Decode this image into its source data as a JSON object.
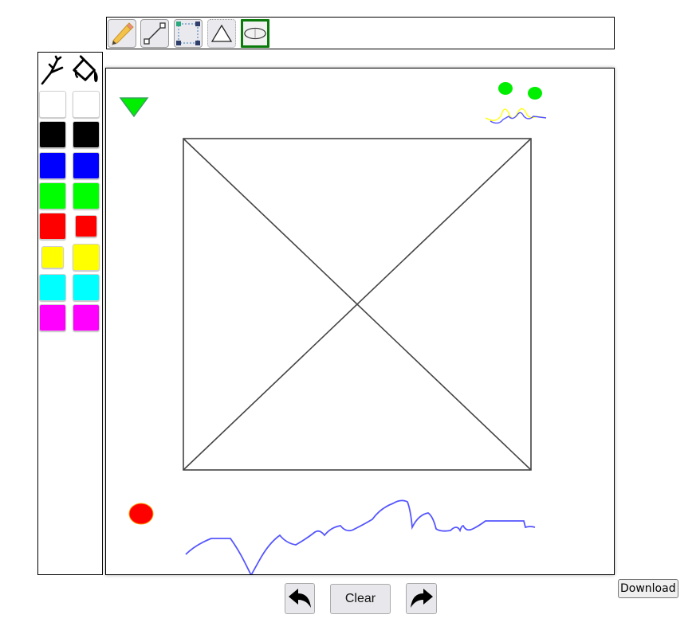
{
  "tools": [
    {
      "id": "pencil",
      "icon": "pencil-icon",
      "active": false
    },
    {
      "id": "line",
      "icon": "line-icon",
      "active": false
    },
    {
      "id": "rectangle",
      "icon": "rectangle-select-icon",
      "active": false
    },
    {
      "id": "triangle",
      "icon": "triangle-icon",
      "active": false
    },
    {
      "id": "ellipse",
      "icon": "ellipse-icon",
      "active": true
    }
  ],
  "modes": [
    {
      "id": "stroke",
      "icon": "branch-stroke-icon"
    },
    {
      "id": "fill",
      "icon": "paint-bucket-icon"
    }
  ],
  "palette": {
    "rows": [
      {
        "color": "#ffffff",
        "stroke": true,
        "fill": true
      },
      {
        "color": "#000000",
        "stroke": true,
        "fill": true
      },
      {
        "color": "#0000ff",
        "stroke": true,
        "fill": true
      },
      {
        "color": "#00ff00",
        "stroke": true,
        "fill": true
      },
      {
        "color": "#ff0000",
        "stroke": true,
        "fill": true
      },
      {
        "color": "#ffff00",
        "stroke": true,
        "fill": true
      },
      {
        "color": "#00ffff",
        "stroke": true,
        "fill": true
      },
      {
        "color": "#ff00ff",
        "stroke": true,
        "fill": true
      }
    ],
    "selected_stroke": "#ffff00",
    "selected_fill": "#ff0000"
  },
  "actions": {
    "undo_icon": "undo-arrow-icon",
    "clear_label": "Clear",
    "redo_icon": "redo-arrow-icon",
    "download_label": "Download"
  },
  "colors": {
    "active_tool_border": "#0a7a0a",
    "shape_stroke": "#444444",
    "scribble_blue": "#5555ff",
    "scribble_yellow": "#ffff00",
    "dot_green": "#00ee00",
    "dot_red": "#ff0000"
  }
}
